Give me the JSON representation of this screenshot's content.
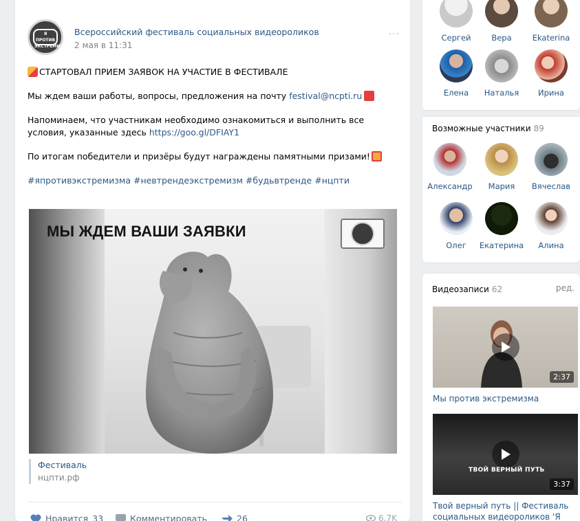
{
  "post": {
    "author": "Всероссийский фестиваль социальных видеороликов",
    "date": "2 мая в 11:31",
    "avatar_text": "Я ПРОТИВ ЭКСТРЕМИЗМА",
    "more_label": "···",
    "line1": "СТАРТОВАЛ ПРИЕМ ЗАЯВОК НА УЧАСТИЕ В ФЕСТИВАЛЕ",
    "line2_prefix": "Мы ждем ваши работы, вопросы, предложения на почту ",
    "email": "festival@ncpti.ru",
    "line3_prefix": "Напоминаем, что участникам необходимо ознакомиться и выполнить все условия, указанные здесь ",
    "url": "https://goo.gl/DFIAY1",
    "line4": "По итогам победители и призёры будут награждены памятными призами!",
    "hashtags": "#япротивэкстремизма #невтрендеэкстремизм #будьвтренде #нцпти",
    "image_title": "МЫ ЖДЕМ ВАШИ ЗАЯВКИ",
    "attachment": {
      "title": "Фестиваль",
      "host": "нцпти.рф"
    },
    "actions": {
      "like_label": "Нравится",
      "like_count": "33",
      "comment_label": "Комментировать",
      "share_count": "26",
      "views": "6.7K"
    }
  },
  "friends": [
    {
      "name": "Сергей"
    },
    {
      "name": "Вера"
    },
    {
      "name": "Ekaterina"
    },
    {
      "name": "Елена"
    },
    {
      "name": "Наталья"
    },
    {
      "name": "Ирина"
    }
  ],
  "members": {
    "title": "Возможные участники",
    "count": "89",
    "people": [
      {
        "name": "Александр"
      },
      {
        "name": "Мария"
      },
      {
        "name": "Вячеслав"
      },
      {
        "name": "Олег"
      },
      {
        "name": "Екатерина"
      },
      {
        "name": "Алина"
      }
    ]
  },
  "videos": {
    "title": "Видеозаписи",
    "count": "62",
    "edit_label": "ред.",
    "items": [
      {
        "title": "Мы против экстремизма",
        "duration": "2:37"
      },
      {
        "title": "Твой верный путь || Фестиваль социальных видеороликов 'Я",
        "duration": "3:37",
        "overlay": "ТВОЙ ВЕРНЫЙ ПУТЬ"
      }
    ]
  },
  "colors": {
    "link": "#2a5885",
    "muted": "#828282",
    "background": "#edeef0"
  },
  "icons": [
    "party-emoji-icon",
    "mailbox-emoji-icon",
    "gift-emoji-icon",
    "heart-icon",
    "comment-icon",
    "share-icon",
    "eye-icon",
    "play-icon"
  ]
}
